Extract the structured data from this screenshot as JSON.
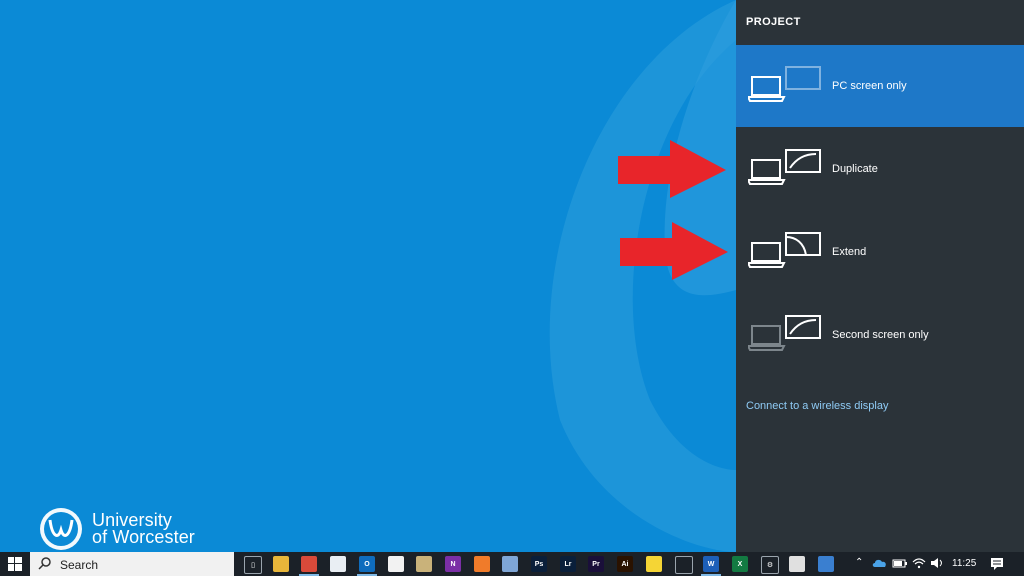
{
  "panel": {
    "title": "PROJECT",
    "options": [
      {
        "label": "PC screen only",
        "selected": true
      },
      {
        "label": "Duplicate",
        "selected": false
      },
      {
        "label": "Extend",
        "selected": false
      },
      {
        "label": "Second screen only",
        "selected": false
      }
    ],
    "wireless_link": "Connect to a wireless display"
  },
  "logo": {
    "line1": "University",
    "line2": "of Worcester"
  },
  "taskbar": {
    "search_placeholder": "Search",
    "clock": "11:25",
    "apps": [
      {
        "name": "task-view-icon",
        "color": "#1b2128",
        "glyph": "▯"
      },
      {
        "name": "file-explorer-icon",
        "color": "#e8b63a",
        "glyph": ""
      },
      {
        "name": "chrome-icon",
        "color": "#d94a3a",
        "glyph": ""
      },
      {
        "name": "document-icon",
        "color": "#e9eef3",
        "glyph": ""
      },
      {
        "name": "outlook-icon",
        "color": "#0f6cbd",
        "glyph": "O"
      },
      {
        "name": "media-icon",
        "color": "#f2f2f2",
        "glyph": ""
      },
      {
        "name": "folder-app-icon",
        "color": "#c9b27a",
        "glyph": ""
      },
      {
        "name": "onenote-icon",
        "color": "#7b2fa6",
        "glyph": "N"
      },
      {
        "name": "firefox-icon",
        "color": "#f07b2a",
        "glyph": ""
      },
      {
        "name": "notepad-icon",
        "color": "#7fa6d6",
        "glyph": ""
      },
      {
        "name": "photoshop-icon",
        "color": "#0a1f3a",
        "glyph": "Ps"
      },
      {
        "name": "lightroom-icon",
        "color": "#0a1f3a",
        "glyph": "Lr"
      },
      {
        "name": "premiere-icon",
        "color": "#1a0f3a",
        "glyph": "Pr"
      },
      {
        "name": "illustrator-icon",
        "color": "#2a1200",
        "glyph": "Ai"
      },
      {
        "name": "sticky-notes-icon",
        "color": "#f5d535",
        "glyph": ""
      },
      {
        "name": "pen-tool-icon",
        "color": "#1b2128",
        "glyph": ""
      },
      {
        "name": "word-icon",
        "color": "#1d5fb8",
        "glyph": "W"
      },
      {
        "name": "excel-icon",
        "color": "#137a42",
        "glyph": "X"
      },
      {
        "name": "settings-icon",
        "color": "#1b2128",
        "glyph": "⚙"
      },
      {
        "name": "snipping-tool-icon",
        "color": "#e0e0e0",
        "glyph": ""
      },
      {
        "name": "photos-icon",
        "color": "#3a7fd0",
        "glyph": ""
      }
    ]
  },
  "colors": {
    "desktop": "#0b8ad6",
    "panel": "#2b3339",
    "selected": "#1e78c8",
    "link": "#8fcbf5",
    "arrow": "#e8252a"
  }
}
